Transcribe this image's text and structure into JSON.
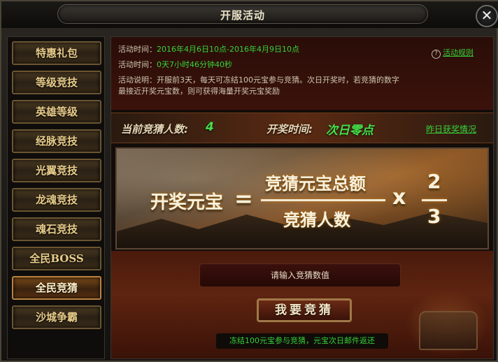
{
  "window": {
    "title": "开服活动"
  },
  "sidebar": {
    "items": [
      {
        "label": "特惠礼包"
      },
      {
        "label": "等级竞技"
      },
      {
        "label": "英雄等级"
      },
      {
        "label": "经脉竞技"
      },
      {
        "label": "光翼竞技"
      },
      {
        "label": "龙魂竞技"
      },
      {
        "label": "魂石竞技"
      },
      {
        "label": "全民BOSS"
      },
      {
        "label": "全民竞猜"
      },
      {
        "label": "沙城争霸"
      }
    ],
    "active": "全民竞猜"
  },
  "info": {
    "time_label": "活动时间：",
    "time_value": "2016年4月6日10点-2016年4月9日10点",
    "remaining_label": "活动时间：",
    "remaining_value": "0天7小时46分钟40秒",
    "desc_label": "活动说明：",
    "desc_line1": "开服前3天，每天可冻结100元宝参与竞猜。次日开奖时，若竞猜的数字",
    "desc_line2": "最接近开奖元宝数，则可获得海量开奖元宝奖励",
    "rules_link": "活动规则"
  },
  "stats": {
    "participants_label": "当前竞猜人数:",
    "participants_value": "4",
    "draw_label": "开奖时间:",
    "draw_value": "次日零点",
    "history_link": "昨日获奖情况"
  },
  "formula": {
    "left": "开奖元宝",
    "equals": "=",
    "numerator": "竞猜元宝总额",
    "denominator": "竞猜人数",
    "times": "x",
    "frac_num": "2",
    "frac_den": "3"
  },
  "guess": {
    "placeholder": "请输入竞猜数值",
    "button": "我要竞猜",
    "footnote": "冻结100元宝参与竞猜，元宝次日邮件返还"
  },
  "colors": {
    "accent_green": "#36d23a",
    "gold": "#e8cc8a"
  }
}
